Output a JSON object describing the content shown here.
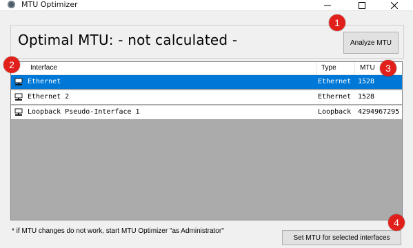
{
  "window": {
    "title": "MTU Optimizer",
    "minimize_glyph": "minimize-icon",
    "maximize_glyph": "maximize-icon",
    "close_glyph": "close-icon"
  },
  "top": {
    "optimal_text": "Optimal MTU: - not calculated -",
    "analyze_label": "Analyze MTU"
  },
  "table": {
    "headers": [
      "Interface",
      "Type",
      "MTU"
    ],
    "rows": [
      {
        "interface": "Ethernet",
        "type": "Ethernet",
        "mtu": "1528",
        "selected": true
      },
      {
        "interface": "Ethernet 2",
        "type": "Ethernet",
        "mtu": "1528",
        "selected": false
      },
      {
        "interface": "Loopback Pseudo-Interface 1",
        "type": "Loopback",
        "mtu": "4294967295",
        "selected": false
      }
    ]
  },
  "footer": {
    "note": "* if MTU changes do not work, start MTU Optimizer \"as Administrator\"",
    "set_label": "Set MTU for selected interfaces"
  },
  "badges": [
    "1",
    "2",
    "3",
    "4"
  ],
  "colors": {
    "selection": "#0078d7",
    "badge": "#e1201b",
    "list_empty": "#ababab"
  }
}
